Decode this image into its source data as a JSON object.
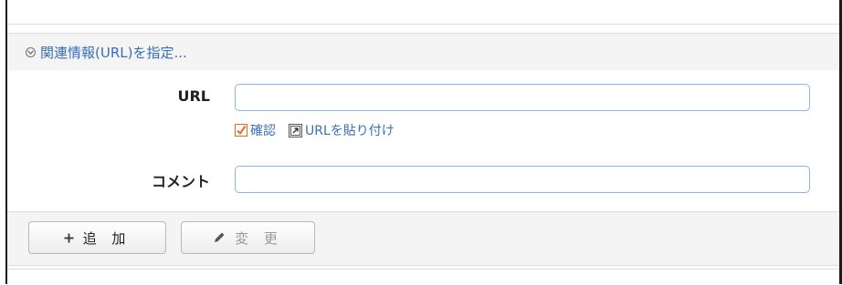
{
  "header": {
    "title": "関連情報(URL)を指定...",
    "icon": "chevron-down-circle-icon"
  },
  "form": {
    "url_label": "URL",
    "url_value": "",
    "confirm_label": "確認",
    "confirm_checked": true,
    "paste_label": "URLを貼り付け",
    "comment_label": "コメント",
    "comment_value": ""
  },
  "buttons": {
    "add_label": "追 加",
    "add_icon": "plus-icon",
    "change_label": "変 更",
    "change_icon": "pencil-icon",
    "change_enabled": false
  },
  "colors": {
    "link": "#3a6fb6",
    "input_border": "#8bb4e6",
    "checkbox": "#e46b1c"
  }
}
